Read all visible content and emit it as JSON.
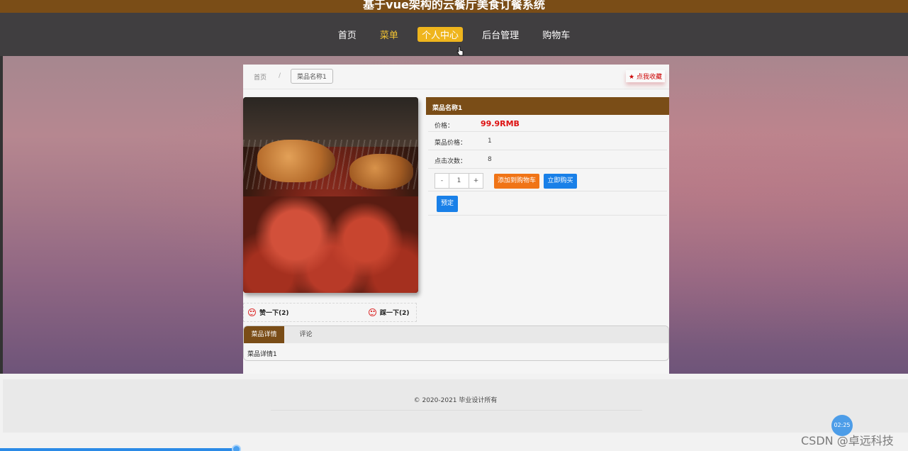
{
  "app": {
    "title": "基于vue架构的云餐厅美食订餐系统"
  },
  "nav": {
    "items": [
      {
        "label": "首页",
        "state": "normal"
      },
      {
        "label": "菜单",
        "state": "yellow"
      },
      {
        "label": "个人中心",
        "state": "active"
      },
      {
        "label": "后台管理",
        "state": "normal"
      },
      {
        "label": "购物车",
        "state": "normal"
      }
    ]
  },
  "breadcrumb": {
    "home": "首页",
    "separator": "/",
    "current": "菜品名称1"
  },
  "favorite": {
    "icon": "star-icon",
    "label": "点我收藏"
  },
  "product": {
    "name": "菜品名称1",
    "price_label": "价格：",
    "price_value": "99.9RMB",
    "rows": [
      {
        "label": "菜品价格：",
        "value": "1"
      },
      {
        "label": "点击次数：",
        "value": "8"
      }
    ],
    "quantity": {
      "minus": "-",
      "value": "1",
      "plus": "+"
    },
    "add_to_cart": "添加到购物车",
    "buy_now": "立即购买",
    "reserve": "预定"
  },
  "votes": {
    "like": {
      "icon": "smiley-icon",
      "label": "赞一下(2)"
    },
    "dislike": {
      "icon": "frown-icon",
      "label": "踩一下(2)"
    }
  },
  "tabs": {
    "items": [
      {
        "label": "菜品详情",
        "active": true
      },
      {
        "label": "评论",
        "active": false
      }
    ],
    "content": "菜品详情1"
  },
  "footer": {
    "copyright": "© 2020-2021 毕业设计所有"
  },
  "video": {
    "time": "02:25",
    "progress": 0.26
  },
  "watermark": "CSDN @卓远科技",
  "colors": {
    "brand": "#7a4d17",
    "accent": "#efb51d",
    "price": "#d11111",
    "cart": "#f07416",
    "primary": "#1980e8"
  }
}
